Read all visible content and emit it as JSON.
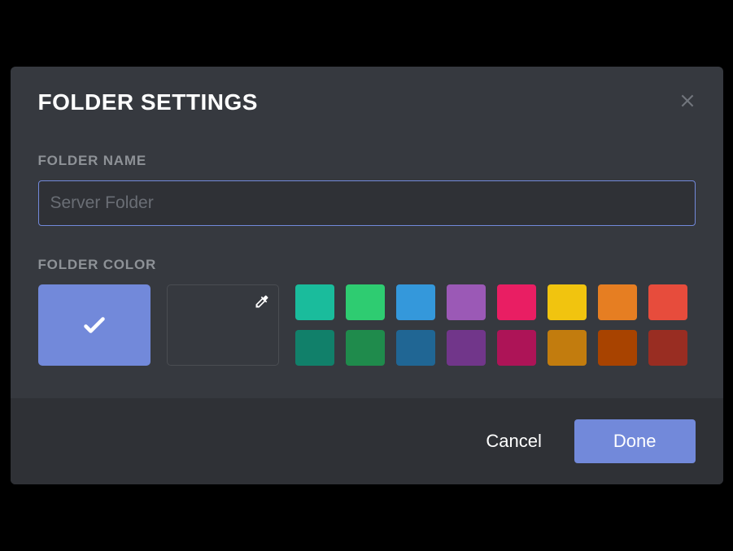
{
  "modal": {
    "title": "Folder Settings",
    "folder_name_label": "Folder Name",
    "folder_name_placeholder": "Server Folder",
    "folder_name_value": "",
    "folder_color_label": "Folder Color",
    "default_color": "#7289da",
    "selected_color_index": -1,
    "swatches": [
      "#1abc9c",
      "#2ecc71",
      "#3498db",
      "#9b59b6",
      "#e91e63",
      "#f1c40f",
      "#e67e22",
      "#e74c3c",
      "#11806a",
      "#1f8b4c",
      "#206694",
      "#71368a",
      "#ad1457",
      "#c27c0e",
      "#a84300",
      "#992d22"
    ]
  },
  "footer": {
    "cancel_label": "Cancel",
    "done_label": "Done"
  }
}
